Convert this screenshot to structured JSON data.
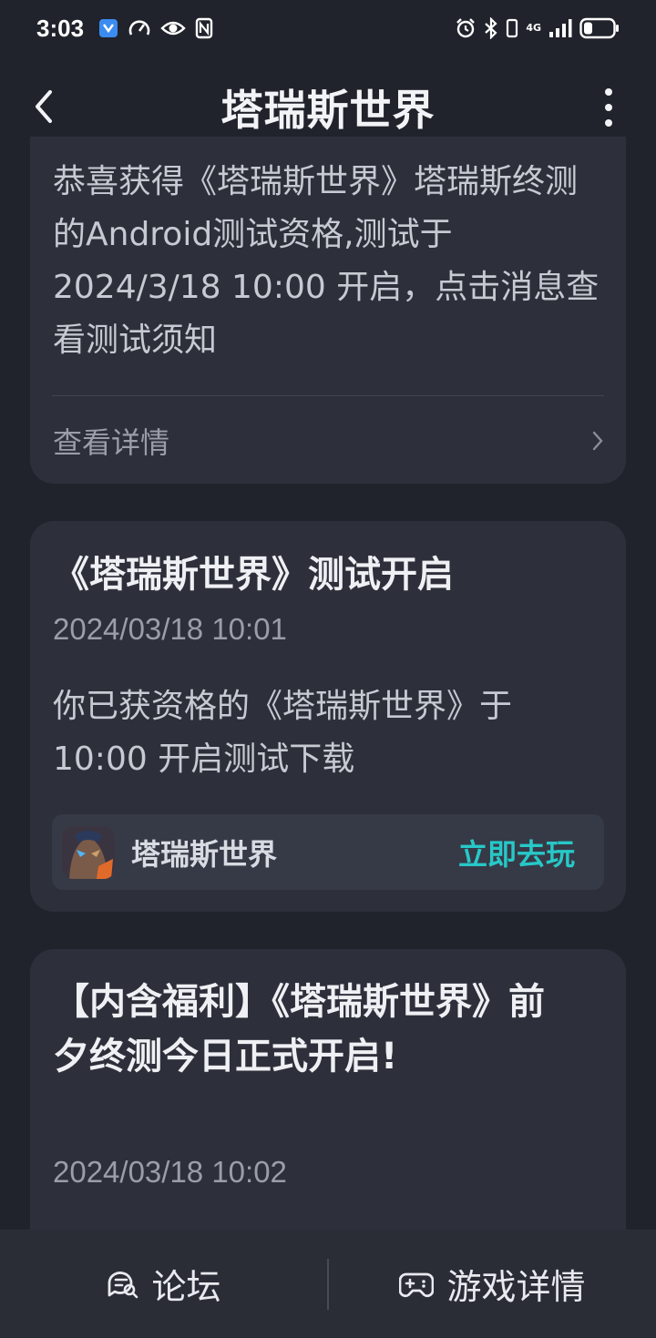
{
  "status": {
    "time": "3:03",
    "network": "4G"
  },
  "header": {
    "title": "塔瑞斯世界"
  },
  "messages": [
    {
      "body": "恭喜获得《塔瑞斯世界》塔瑞斯终测的Android测试资格,测试于2024/3/18 10:00 开启，点击消息查看测试须知",
      "action_label": "查看详情"
    },
    {
      "title": "《塔瑞斯世界》测试开启",
      "date": "2024/03/18 10:01",
      "body": "你已获资格的《塔瑞斯世界》于10:00 开启测试下载",
      "game_name": "塔瑞斯世界",
      "play_label": "立即去玩"
    },
    {
      "title": "【内含福利】《塔瑞斯世界》前夕终测今日正式开启!",
      "date": "2024/03/18 10:02"
    }
  ],
  "bottom_bar": {
    "forum_label": "论坛",
    "details_label": "游戏详情"
  },
  "colors": {
    "background": "#20232b",
    "card": "#2d303a",
    "accent": "#27c8c8"
  }
}
